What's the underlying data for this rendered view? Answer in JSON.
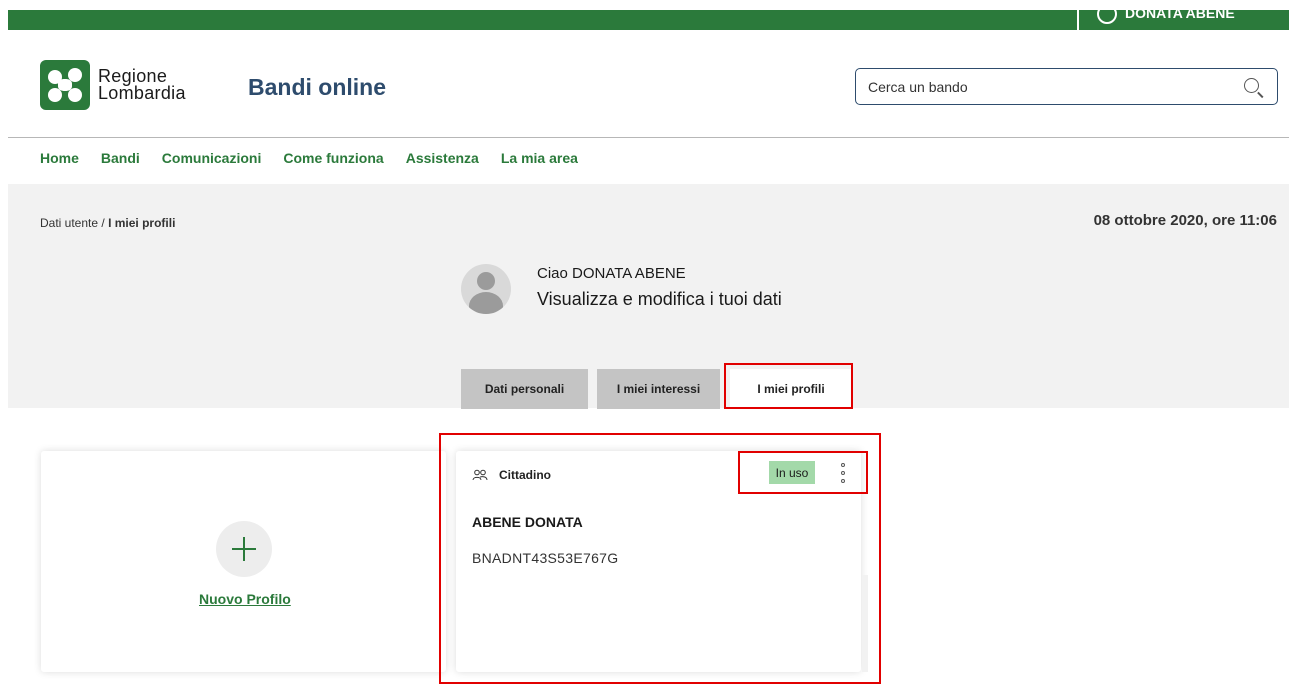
{
  "topbar": {
    "user_name": "DONATA ABENE"
  },
  "header": {
    "logo_line1": "Regione",
    "logo_line2": "Lombardia",
    "site_title": "Bandi online",
    "search_placeholder": "Cerca un bando"
  },
  "nav": {
    "items": [
      {
        "label": "Home"
      },
      {
        "label": "Bandi"
      },
      {
        "label": "Comunicazioni"
      },
      {
        "label": "Come funziona"
      },
      {
        "label": "Assistenza"
      },
      {
        "label": "La mia area"
      }
    ]
  },
  "breadcrumb": {
    "parent": "Dati utente",
    "separator": "/",
    "current": "I miei profili"
  },
  "datetime": "08 ottobre 2020, ore 11:06",
  "user": {
    "greeting": "Ciao DONATA ABENE",
    "subtitle": "Visualizza e modifica i tuoi dati"
  },
  "tabs": {
    "items": [
      {
        "label": "Dati personali"
      },
      {
        "label": "I miei interessi"
      },
      {
        "label": "I miei profili"
      }
    ],
    "active": "I miei profili"
  },
  "new_profile": {
    "label": "Nuovo Profilo"
  },
  "profile_card": {
    "type": "Cittadino",
    "status_badge": "In uso",
    "name": "ABENE DONATA",
    "code": "BNADNT43S53E767G"
  },
  "colors": {
    "brand_green": "#2b7a3b",
    "title_blue": "#2e4c6d",
    "badge_green": "#a3d9a9",
    "highlight_red": "#e10000",
    "panel_gray": "#f2f2f2"
  }
}
